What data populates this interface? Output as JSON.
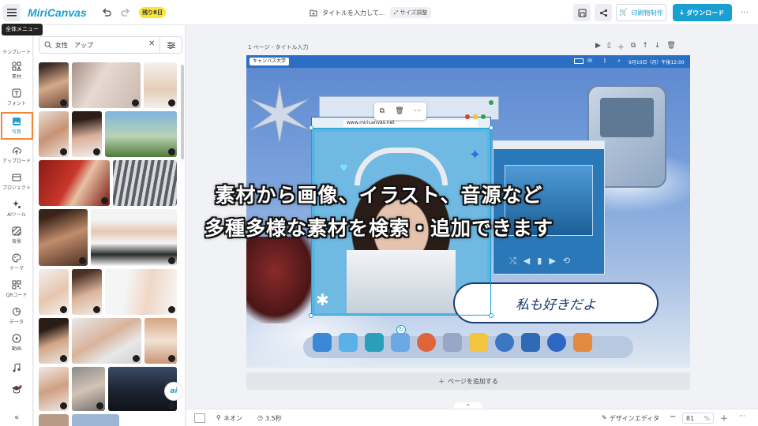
{
  "topbar": {
    "logo": "MiriCanvas",
    "trial_badge": "残り8日",
    "doc_title": "タイトルを入力して...",
    "resize_label": "サイズ調整",
    "print_label": "印刷物制作",
    "download_label": "ダウンロード",
    "menu_tooltip": "全体メニュー"
  },
  "rail": {
    "items": [
      {
        "label": "テンプレート",
        "icon": "template-icon"
      },
      {
        "label": "素材",
        "icon": "elements-icon"
      },
      {
        "label": "フォント",
        "icon": "text-icon"
      },
      {
        "label": "写真",
        "icon": "photo-icon"
      },
      {
        "label": "アップロード",
        "icon": "upload-icon"
      },
      {
        "label": "プロジェクト",
        "icon": "folder-icon"
      },
      {
        "label": "AIツール",
        "icon": "ai-sparkle-icon"
      },
      {
        "label": "背景",
        "icon": "background-icon"
      },
      {
        "label": "テーマ",
        "icon": "palette-icon"
      },
      {
        "label": "QRコード",
        "icon": "qr-code-icon"
      },
      {
        "label": "データ",
        "icon": "chart-icon"
      },
      {
        "label": "動画",
        "icon": "video-icon"
      },
      {
        "label": "",
        "icon": "music-icon"
      }
    ]
  },
  "panel": {
    "search_value": "女性　アップ"
  },
  "page": {
    "label": "1 ページ - タイトル入力",
    "header_tag": "キャンパス大学",
    "header_date": "9月10日（月）午後12:00",
    "url": "www.miricanvas.net",
    "speech": "私も好きだよ"
  },
  "canvas": {
    "add_page": "ページを追加する"
  },
  "overlay": {
    "line1": "素材から画像、イラスト、音源など",
    "line2": "多種多様な素材を検索・追加できます"
  },
  "bottombar": {
    "animation": "ネオン",
    "duration": "3.5秒",
    "design_editor": "デザインエディタ",
    "zoom": "81",
    "zoom_unit": "%"
  },
  "colors": {
    "accent": "#1a9fd1",
    "badge": "#f9e43a",
    "highlight": "#f0883a"
  }
}
